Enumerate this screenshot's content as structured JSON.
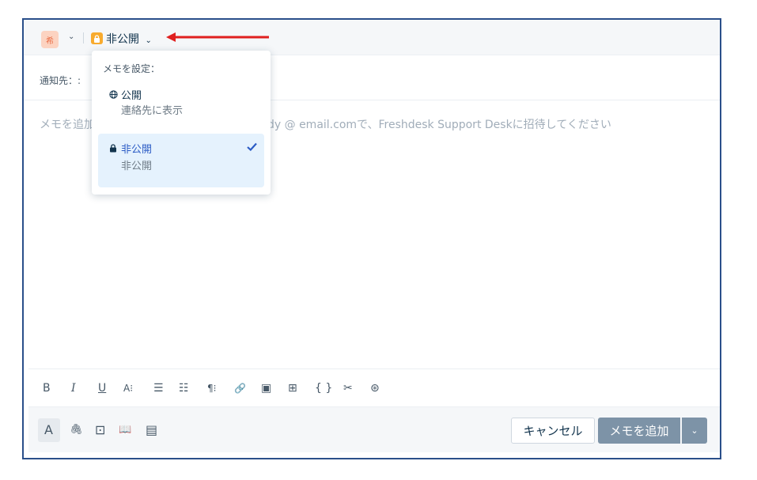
{
  "header": {
    "avatar_text": "希",
    "visibility_label": "非公開",
    "chevron": "⌄",
    "avatar_color": "#fcd3c1",
    "lock_color": "#f8ab2e",
    "arrow_color": "#e02020"
  },
  "notify": {
    "label": "通知先：:"
  },
  "editor": {
    "placeholder_left": "メモを追加",
    "placeholder_right": "dy @ email.comで、Freshdesk Support Deskに招待してください"
  },
  "dropdown": {
    "heading": "メモを設定：",
    "options": [
      {
        "icon": "globe-icon",
        "title": "公開",
        "subtitle": "連絡先に表示",
        "selected": false
      },
      {
        "icon": "lock-icon",
        "title": "非公開",
        "subtitle": "非公開",
        "selected": true
      }
    ],
    "selected_bg": "#e5f2fd",
    "selected_color": "#2c5cc5"
  },
  "format_toolbar": {
    "bold": "B",
    "italic": "I",
    "underline": "U",
    "font_size": "A⁝",
    "ordered_list": "☰",
    "bullet_list": "☷",
    "paragraph": "¶⁝",
    "link": "🔗",
    "image": "▣",
    "table": "⊞",
    "code": "{ }",
    "clear_format": "✂",
    "canned": "⊛"
  },
  "footer": {
    "text_tool": "A",
    "attach": "🖇",
    "canned_response": "⊡",
    "knowledge_base": "📖",
    "note_template": "▤",
    "cancel_label": "キャンセル",
    "add_note_label": "メモを追加",
    "add_note_menu": "⌄",
    "add_button_color": "#7d93a7"
  }
}
